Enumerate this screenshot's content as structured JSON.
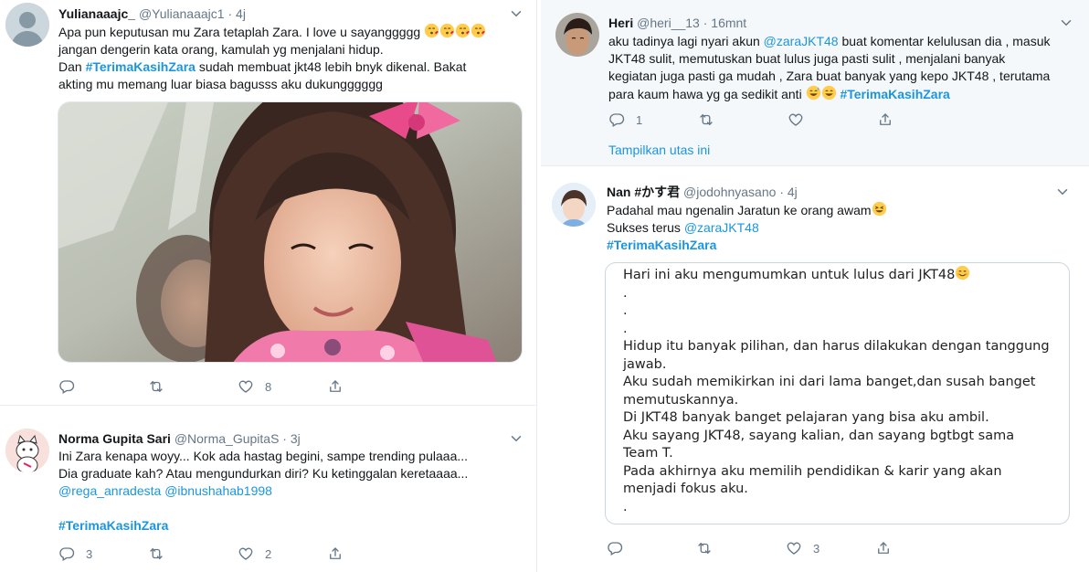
{
  "tweets": [
    {
      "name": "Yulianaaajc_",
      "handle": "@Yulianaaajc1",
      "time": "4j",
      "lines": [
        "Apa pun keputusan mu Zara tetaplah Zara. I love u sayanggggg",
        "jangan dengerin kata orang, kamulah yg menjalani hidup."
      ],
      "line3_prefix": "Dan ",
      "line3_hashtag": "#TerimaKasihZara",
      "line3_suffix": " sudah membuat jkt48 lebih bnyk dikenal. Bakat",
      "line4": "akting mu memang luar biasa bagusss aku dukungggggg",
      "photo_alt": "Photo of Zara smiling with a pink bow",
      "likes": "8"
    },
    {
      "name": "Norma Gupita Sari",
      "handle": "@Norma_GupitaS",
      "time": "3j",
      "lines": [
        "Ini Zara kenapa woyy... Kok ada hastag begini, sampe trending pulaaa...",
        "Dia graduate kah? Atau mengundurkan diri? Ku ketinggalan keretaaaa..."
      ],
      "mention1": "@rega_anradesta",
      "mention2": "@ibnushahab1998",
      "hashtag": "#TerimaKasihZara",
      "replies": "3",
      "likes": "2"
    },
    {
      "name": "Heri",
      "handle": "@heri__13",
      "time": "16mnt",
      "line1_prefix": "aku tadinya lagi nyari akun ",
      "line1_mention": "@zaraJKT48",
      "line1_suffix": " buat komentar kelulusan dia , masuk",
      "line2": "JKT48 sulit, memutuskan buat lulus juga pasti sulit , menjalani banyak",
      "line3": "kegiatan juga pasti ga mudah , Zara buat banyak yang kepo JKT48 , terutama",
      "line4_prefix": "para kaum hawa yg ga sedikit anti ",
      "line4_hashtag": "#TerimaKasihZara",
      "replies": "1",
      "show_thread": "Tampilkan utas ini"
    },
    {
      "name": "Nan #かす君",
      "handle": "@jodohnyasano",
      "time": "4j",
      "line1": "Padahal mau ngenalin Jaratun ke orang awam",
      "line2_prefix": "Sukses terus ",
      "line2_mention": "@zaraJKT48",
      "hashtag": "#TerimaKasihZara",
      "quoted_lines": [
        "Hari ini aku mengumumkan untuk lulus dari JKT48",
        ".",
        ".",
        ".",
        "Hidup itu banyak pilihan, dan harus dilakukan dengan tanggung",
        "jawab.",
        "Aku sudah memikirkan ini dari lama banget,dan susah banget",
        "memutuskannya.",
        "Di JKT48 banyak banget pelajaran yang bisa aku ambil.",
        "Aku sayang JKT48, sayang kalian, dan sayang bgtbgt sama",
        "Team T.",
        "Pada akhirnya aku memilih pendidikan & karir yang akan",
        "menjadi fokus aku.",
        "."
      ],
      "likes": "3"
    }
  ],
  "dot": "·",
  "colors": {
    "link": "#1b95e0",
    "muted": "#657786",
    "border": "#e6ecf0"
  }
}
